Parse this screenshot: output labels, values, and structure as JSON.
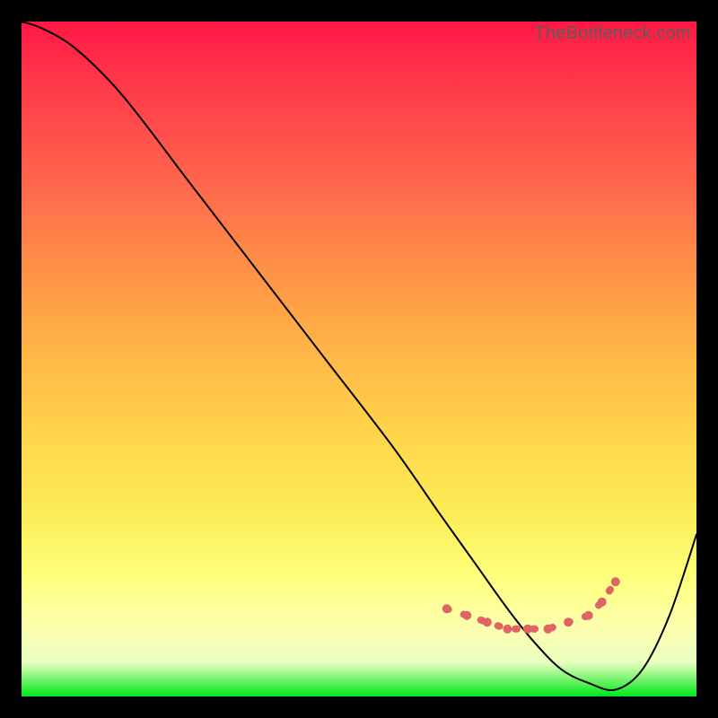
{
  "watermark": "TheBottleneck.com",
  "chart_data": {
    "type": "line",
    "title": "",
    "xlabel": "",
    "ylabel": "",
    "xlim": [
      0,
      100
    ],
    "ylim": [
      0,
      100
    ],
    "grid": false,
    "legend": false,
    "background_gradient": {
      "stops": [
        {
          "pos": 0.0,
          "color": "#ff1744"
        },
        {
          "pos": 0.1,
          "color": "#ff3b4a"
        },
        {
          "pos": 0.25,
          "color": "#ff6a4d"
        },
        {
          "pos": 0.36,
          "color": "#ff8f47"
        },
        {
          "pos": 0.48,
          "color": "#ffb347"
        },
        {
          "pos": 0.6,
          "color": "#ffd24a"
        },
        {
          "pos": 0.72,
          "color": "#fceb55"
        },
        {
          "pos": 0.82,
          "color": "#feff7a"
        },
        {
          "pos": 0.9,
          "color": "#fdffb0"
        },
        {
          "pos": 0.95,
          "color": "#e8ffbf"
        },
        {
          "pos": 1.0,
          "color": "#00e61a"
        }
      ]
    },
    "series": [
      {
        "name": "curve",
        "color": "#000000",
        "width": 2,
        "x": [
          0,
          3,
          8,
          15,
          25,
          35,
          45,
          55,
          62,
          67,
          72,
          76,
          80,
          84,
          88,
          92,
          96,
          100
        ],
        "y": [
          100,
          99,
          96,
          89,
          76,
          63,
          50,
          37,
          27,
          20,
          13,
          8,
          4,
          2,
          1,
          4,
          12,
          24
        ]
      },
      {
        "name": "highlight-dots",
        "type": "scatter",
        "color": "#e06464",
        "radius": 5,
        "x": [
          63,
          66,
          69,
          72,
          75,
          78,
          81,
          84,
          86,
          88
        ],
        "y": [
          13,
          12,
          11,
          10,
          10,
          10,
          11,
          12,
          14,
          17
        ]
      }
    ]
  }
}
